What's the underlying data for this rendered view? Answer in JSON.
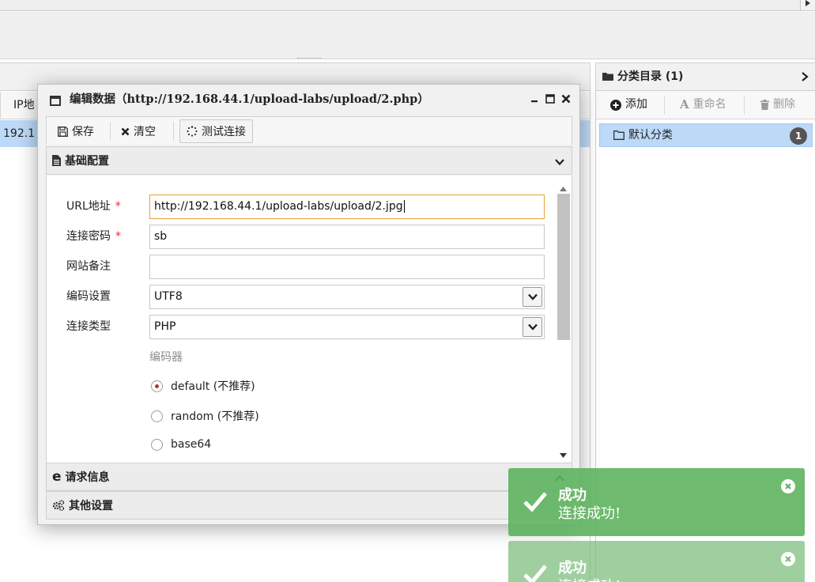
{
  "background": {
    "ip_column_header": "IP地",
    "ip_cell": "192.1"
  },
  "category_panel": {
    "title": "分类目录 (1)",
    "add_label": "添加",
    "rename_label": "重命名",
    "delete_label": "删除",
    "item_label": "默认分类",
    "item_count": "1"
  },
  "dialog": {
    "title": "编辑数据（http://192.168.44.1/upload-labs/upload/2.php）",
    "toolbar": {
      "save_label": "保存",
      "clear_label": "清空",
      "test_label": "测试连接"
    },
    "basic_section_label": "基础配置",
    "request_section_label": "请求信息",
    "other_section_label": "其他设置",
    "form": {
      "url_label": "URL地址",
      "url_value": "http://192.168.44.1/upload-labs/upload/2.jpg",
      "password_label": "连接密码",
      "password_value": "sb",
      "note_label": "网站备注",
      "note_value": "",
      "encoding_label": "编码设置",
      "encoding_value": "UTF8",
      "type_label": "连接类型",
      "type_value": "PHP",
      "encoder_label": "编码器",
      "required_mark": "*",
      "encoders": [
        {
          "label": "default (不推荐)",
          "selected": true
        },
        {
          "label": "random (不推荐)",
          "selected": false
        },
        {
          "label": "base64",
          "selected": false
        }
      ]
    }
  },
  "toasts": [
    {
      "title": "成功",
      "message": "连接成功!"
    },
    {
      "title": "成功",
      "message": "连接成功!"
    }
  ],
  "colors": {
    "toast_success": "#5eb25e",
    "selection": "#bcd9f8",
    "focus_border": "#e0a33a",
    "required": "#e22233"
  }
}
